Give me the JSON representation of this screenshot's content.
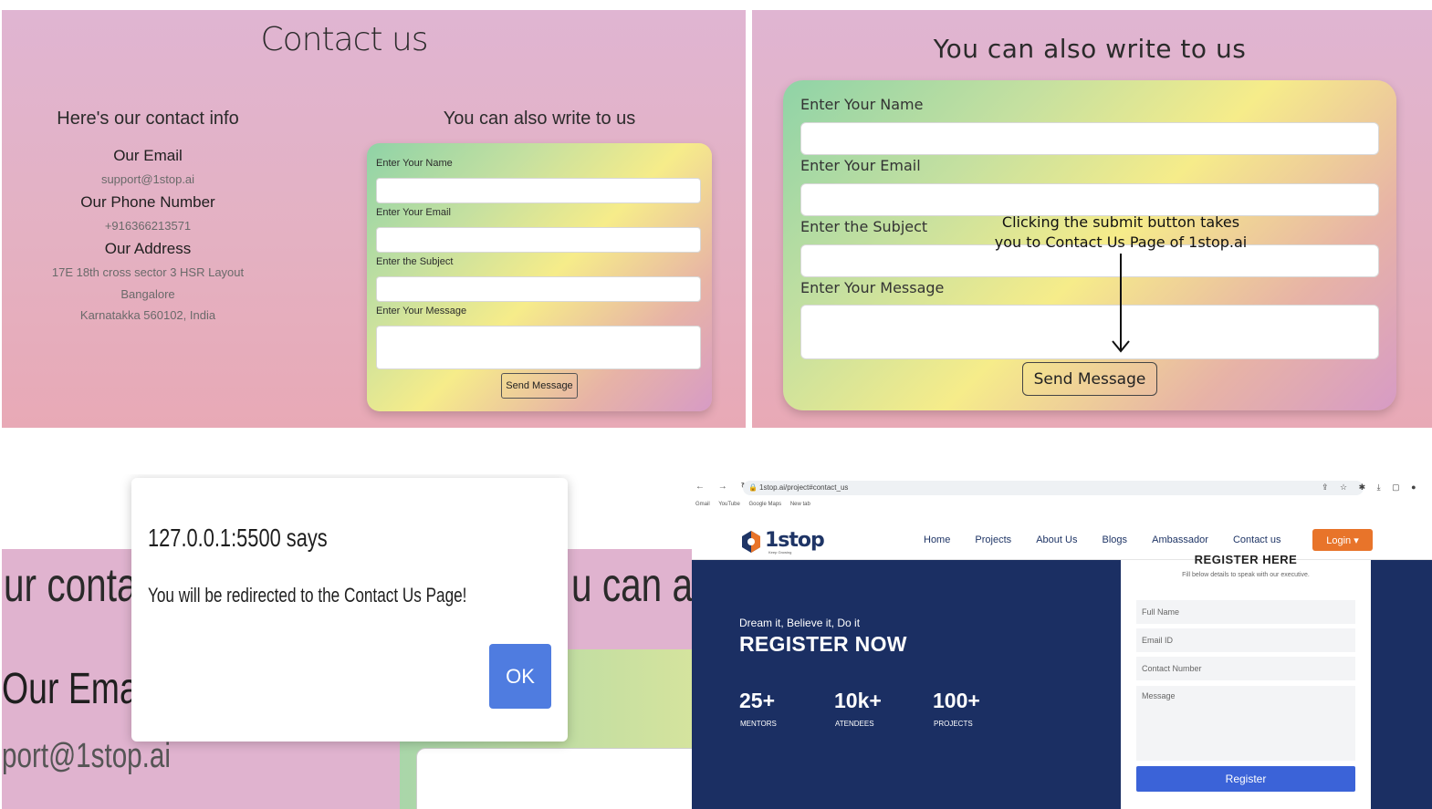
{
  "panel1": {
    "title": "Contact us",
    "info_heading": "Here's our contact info",
    "email_label": "Our Email",
    "email_value": "support@1stop.ai",
    "phone_label": "Our Phone Number",
    "phone_value": "+916366213571",
    "address_label": "Our Address",
    "address_line1": "17E 18th cross sector 3 HSR Layout",
    "address_line2": "Bangalore",
    "address_line3": "Karnatakka 560102, India",
    "form_heading": "You can also write to us",
    "name_label": "Enter Your Name",
    "email_field_label": "Enter Your Email",
    "subject_label": "Enter the Subject",
    "message_label": "Enter Your Message",
    "send_label": "Send Message"
  },
  "panel2": {
    "title": "You can also write to us",
    "name_label": "Enter Your Name",
    "email_field_label": "Enter Your Email",
    "subject_label": "Enter the Subject",
    "message_label": "Enter Your Message",
    "send_label": "Send Message",
    "annotation_line1": "Clicking the submit button takes",
    "annotation_line2": "you to Contact Us Page of 1stop.ai"
  },
  "panel3": {
    "bg_text1": "ur contact",
    "bg_text2": "u can also",
    "bg_text3": "Our Email",
    "bg_text4": "port@1stop.ai",
    "dialog_title": "127.0.0.1:5500 says",
    "dialog_message": "You will be redirected to the Contact Us Page!",
    "ok_label": "OK"
  },
  "panel4": {
    "url": "1stop.ai/project#contact_us",
    "bookmarks": [
      "Gmail",
      "YouTube",
      "Google Maps",
      "New tab"
    ],
    "logo": "1stop",
    "logo_tag": "Keep Growing",
    "nav": [
      "Home",
      "Projects",
      "About Us",
      "Blogs",
      "Ambassador",
      "Contact us"
    ],
    "login_label": "Login ▾",
    "tagline": "Dream it, Believe it, Do it",
    "heading": "REGISTER NOW",
    "stats": [
      {
        "num": "25+",
        "label": "MENTORS"
      },
      {
        "num": "10k+",
        "label": "ATENDEES"
      },
      {
        "num": "100+",
        "label": "PROJECTS"
      }
    ],
    "form_title": "REGISTER HERE",
    "form_sub": "Fill below details to speak with our executive.",
    "full_name": "Full Name",
    "email_id": "Email ID",
    "contact_number": "Contact Number",
    "message": "Message",
    "register_label": "Register"
  }
}
